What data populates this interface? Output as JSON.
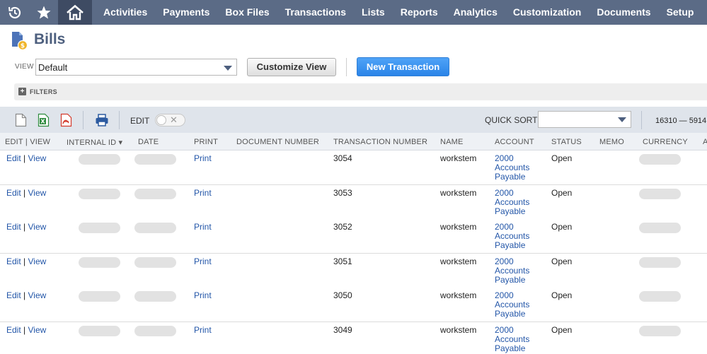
{
  "nav": {
    "items": [
      "Activities",
      "Payments",
      "Box Files",
      "Transactions",
      "Lists",
      "Reports",
      "Analytics",
      "Customization",
      "Documents",
      "Setup"
    ]
  },
  "header": {
    "title": "Bills"
  },
  "view": {
    "label": "VIEW",
    "selected": "Default"
  },
  "buttons": {
    "customize": "Customize View",
    "new_transaction": "New Transaction"
  },
  "filters": {
    "label": "FILTERS"
  },
  "toolbar": {
    "edit_label": "EDIT",
    "quick_sort_label": "QUICK SORT",
    "quick_sort_value": "",
    "range_text": "16310 — 5914"
  },
  "table": {
    "headers": [
      "EDIT | VIEW",
      "INTERNAL ID ▾",
      "DATE",
      "PRINT",
      "DOCUMENT NUMBER",
      "TRANSACTION NUMBER",
      "NAME",
      "ACCOUNT",
      "STATUS",
      "MEMO",
      "CURRENCY",
      "A"
    ],
    "rows": [
      {
        "edit": "Edit",
        "view": "View",
        "print": "Print",
        "txn": "3054",
        "name": "workstem",
        "acct1": "2000",
        "acct2": "Accounts",
        "acct3": "Payable",
        "status": "Open"
      },
      {
        "edit": "Edit",
        "view": "View",
        "print": "Print",
        "txn": "3053",
        "name": "workstem",
        "acct1": "2000",
        "acct2": "Accounts",
        "acct3": "Payable",
        "status": "Open"
      },
      {
        "edit": "Edit",
        "view": "View",
        "print": "Print",
        "txn": "3052",
        "name": "workstem",
        "acct1": "2000",
        "acct2": "Accounts",
        "acct3": "Payable",
        "status": "Open"
      },
      {
        "edit": "Edit",
        "view": "View",
        "print": "Print",
        "txn": "3051",
        "name": "workstem",
        "acct1": "2000",
        "acct2": "Accounts",
        "acct3": "Payable",
        "status": "Open"
      },
      {
        "edit": "Edit",
        "view": "View",
        "print": "Print",
        "txn": "3050",
        "name": "workstem",
        "acct1": "2000",
        "acct2": "Accounts",
        "acct3": "Payable",
        "status": "Open"
      },
      {
        "edit": "Edit",
        "view": "View",
        "print": "Print",
        "txn": "3049",
        "name": "workstem",
        "acct1": "2000",
        "acct2": "Accounts",
        "acct3": "Payable",
        "status": "Open"
      }
    ]
  },
  "colors": {
    "nav_bg": "#5b6b86",
    "nav_active": "#3e4b63",
    "link": "#2356a8",
    "primary_button": "#2a84e8",
    "title": "#4d5f7e"
  },
  "icons": [
    "history-icon",
    "star-icon",
    "home-icon",
    "bills-icon",
    "new-document-icon",
    "excel-export-icon",
    "pdf-export-icon",
    "print-icon"
  ]
}
